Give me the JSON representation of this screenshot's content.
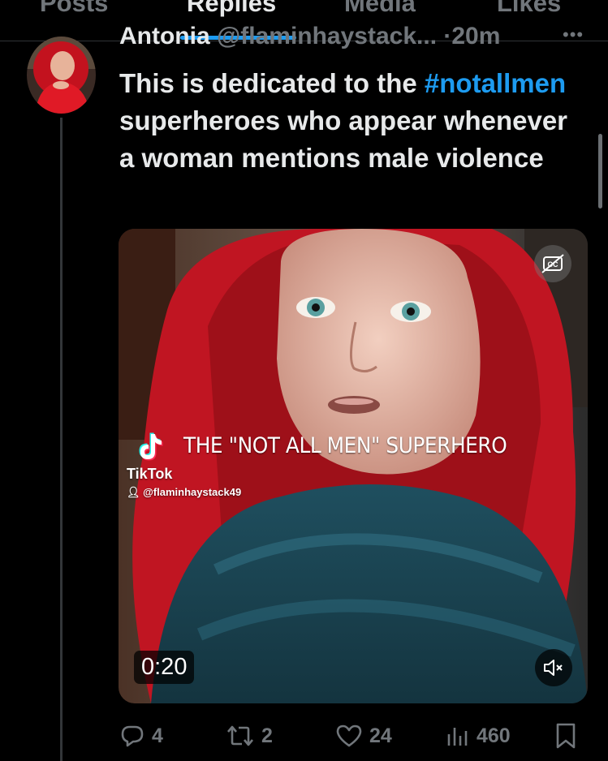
{
  "tabs": [
    {
      "label": "Posts"
    },
    {
      "label": "Replies"
    },
    {
      "label": "Media"
    },
    {
      "label": "Likes"
    }
  ],
  "active_tab": "Replies",
  "tweet": {
    "author_name": "Antonia",
    "author_handle": "@flaminhaystack...",
    "separator": "·",
    "time": "20m",
    "text_before": "This is dedicated to the",
    "hashtag": "#notallmen",
    "text_after": "superheroes who appear whenever a woman mentions male violence"
  },
  "media": {
    "caption": "THE \"NOT ALL MEN\" SUPERHERO",
    "brand": "TikTok",
    "tiktok_handle": "@flaminhaystack49",
    "duration": "0:20",
    "cc_icon": "closed-captions-icon",
    "mute_icon": "muted-speaker-icon"
  },
  "actions": {
    "replies": "4",
    "reposts": "2",
    "likes": "24",
    "views": "460"
  },
  "colors": {
    "accent": "#1d9bf0",
    "muted": "#71767b",
    "text": "#e7e9ea",
    "background": "#000000"
  }
}
